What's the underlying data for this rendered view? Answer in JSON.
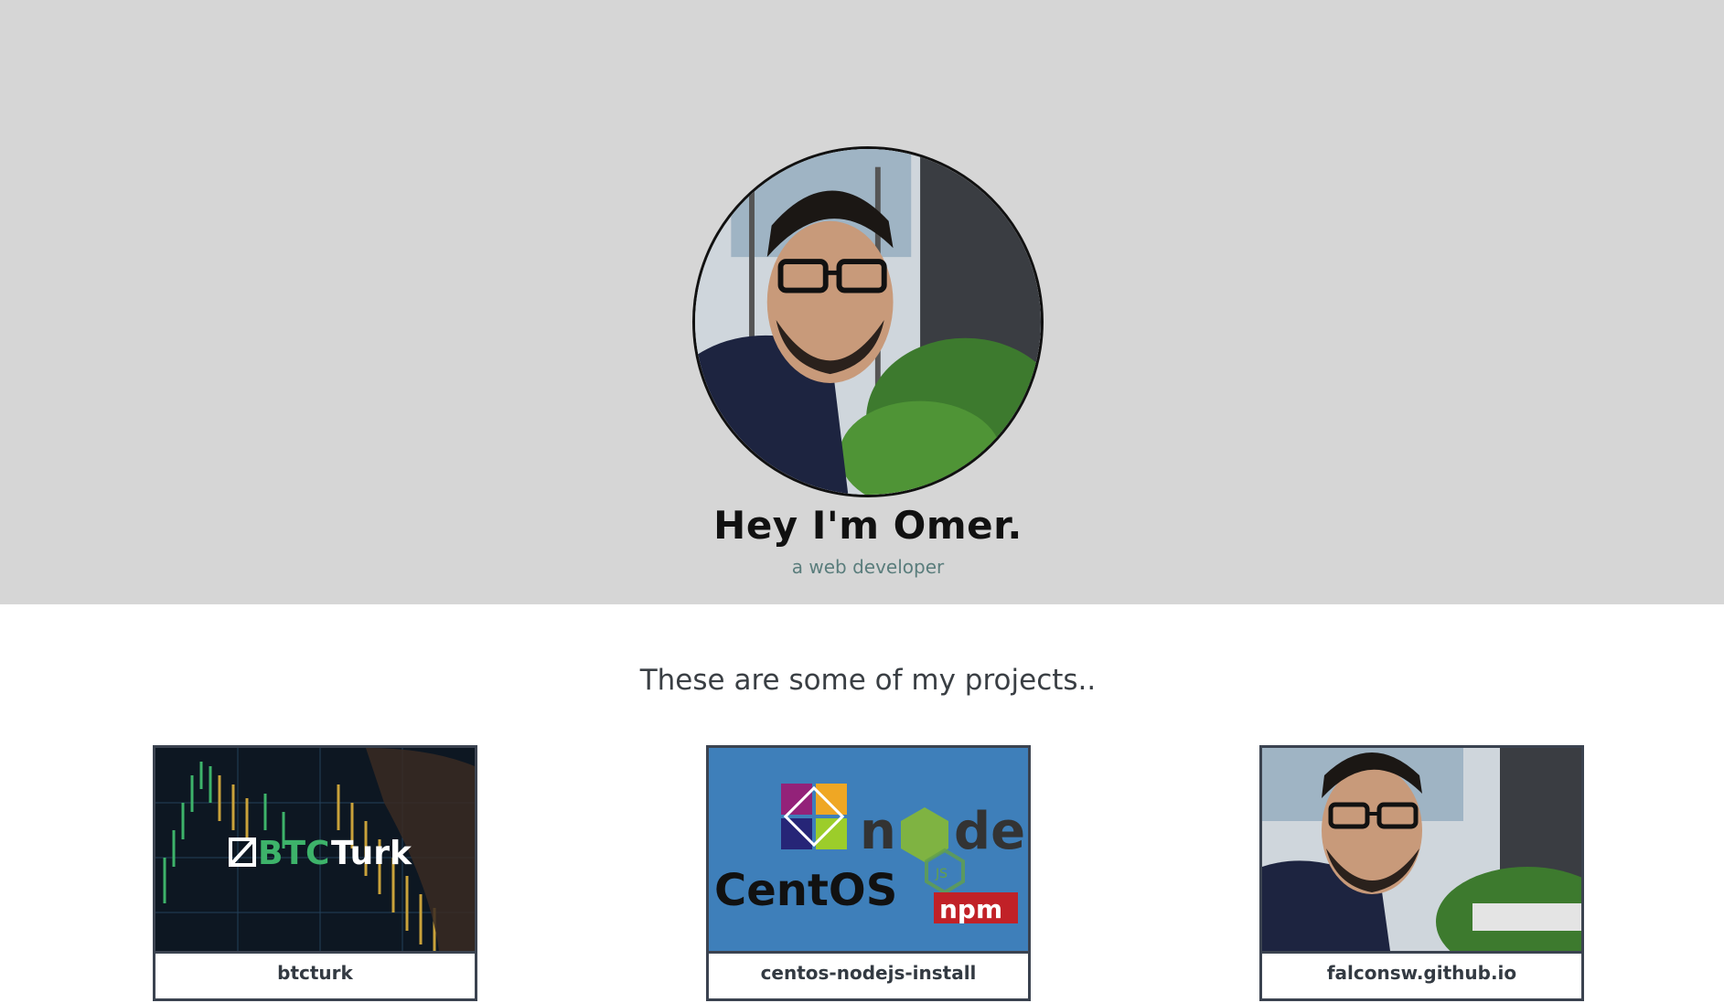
{
  "hero": {
    "title": "Hey I'm Omer.",
    "subtitle": "a web developer",
    "background_color": "#d6d6d6"
  },
  "projects": {
    "heading": "These are some of my projects..",
    "items": [
      {
        "label": "btcturk",
        "thumb_text": "BTCTurk",
        "icon": "btcturk-logo"
      },
      {
        "label": "centos-nodejs-install",
        "thumb_text": [
          "CentOS",
          "node",
          "npm"
        ],
        "icon": "centos-node-npm-logos"
      },
      {
        "label": "falconsw.github.io",
        "icon": "profile-photo"
      }
    ]
  },
  "colors": {
    "accent_subtitle": "#5a7d7c",
    "card_border": "#3b4350",
    "btc_green": "#3db36a",
    "centos_bg": "#3e7fba",
    "npm_red": "#c12127"
  }
}
